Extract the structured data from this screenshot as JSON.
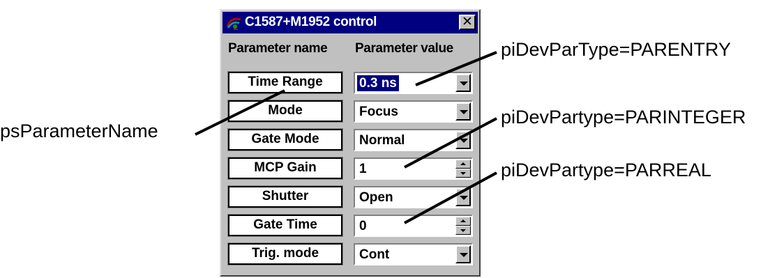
{
  "window": {
    "title": "C1587+M1952 control",
    "close_glyph": "✕",
    "icon": "hamamatsu-app-icon"
  },
  "columns": {
    "name_header": "Parameter name",
    "value_header": "Parameter value"
  },
  "parameters": [
    {
      "name": "Time Range",
      "value": "0.3 ns",
      "control": "dropdown",
      "selected": true
    },
    {
      "name": "Mode",
      "value": "Focus",
      "control": "dropdown"
    },
    {
      "name": "Gate Mode",
      "value": "Normal",
      "control": "dropdown"
    },
    {
      "name": "MCP Gain",
      "value": "1",
      "control": "spinner"
    },
    {
      "name": "Shutter",
      "value": "Open",
      "control": "dropdown"
    },
    {
      "name": "Gate Time",
      "value": "0",
      "control": "spinner"
    },
    {
      "name": "Trig. mode",
      "value": "Cont",
      "control": "dropdown"
    }
  ],
  "annotations": {
    "entry": "piDevParType=PARENTRY",
    "integer": "piDevPartype=PARINTEGER",
    "real": "piDevPartype=PARREAL",
    "name": "psParameterName"
  },
  "colors": {
    "titlebar": "#000080",
    "face": "#c0c0c0",
    "selection": "#000080"
  }
}
